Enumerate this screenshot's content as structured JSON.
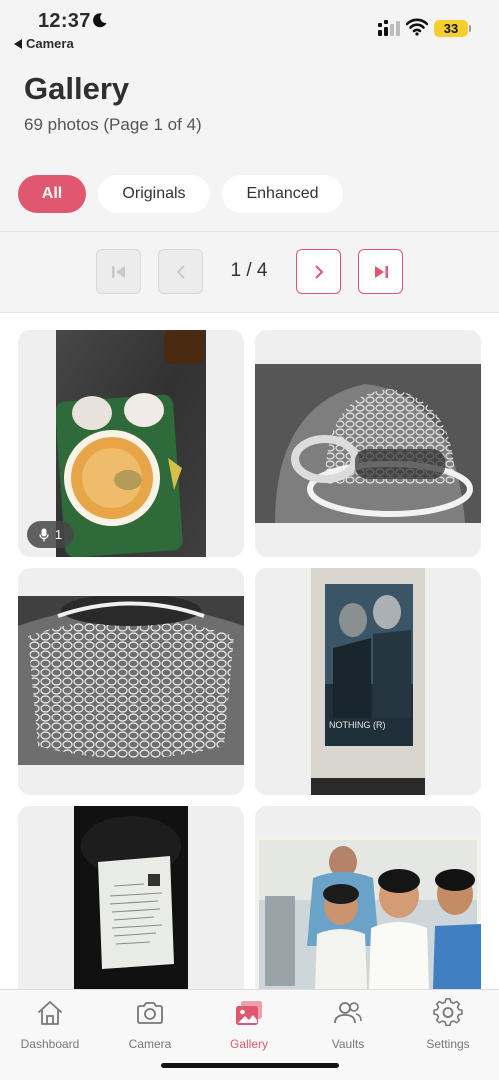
{
  "status": {
    "time": "12:37",
    "back_app": "Camera",
    "battery": "33"
  },
  "header": {
    "title": "Gallery",
    "subtitle": "69 photos (Page 1 of 4)"
  },
  "filters": [
    {
      "label": "All",
      "active": true
    },
    {
      "label": "Originals",
      "active": false
    },
    {
      "label": "Enhanced",
      "active": false
    }
  ],
  "pagination": {
    "current": 1,
    "total": 4,
    "indicator": "1 / 4"
  },
  "photos": [
    {
      "subject": "food tray with omelette and eggs",
      "audio_count": "1"
    },
    {
      "subject": "textured glass cup close-up"
    },
    {
      "subject": "textured glass bowl close-up"
    },
    {
      "subject": "movie poster",
      "poster_text": "NOTHING (R)"
    },
    {
      "subject": "printed document on dark background"
    },
    {
      "subject": "group of children photo"
    }
  ],
  "tabbar": {
    "items": [
      {
        "label": "Dashboard",
        "icon": "home-icon"
      },
      {
        "label": "Camera",
        "icon": "camera-icon"
      },
      {
        "label": "Gallery",
        "icon": "gallery-icon",
        "active": true
      },
      {
        "label": "Vaults",
        "icon": "users-icon"
      },
      {
        "label": "Settings",
        "icon": "gear-icon"
      }
    ]
  },
  "colors": {
    "accent": "#e05870",
    "background": "#f4f4f4"
  }
}
